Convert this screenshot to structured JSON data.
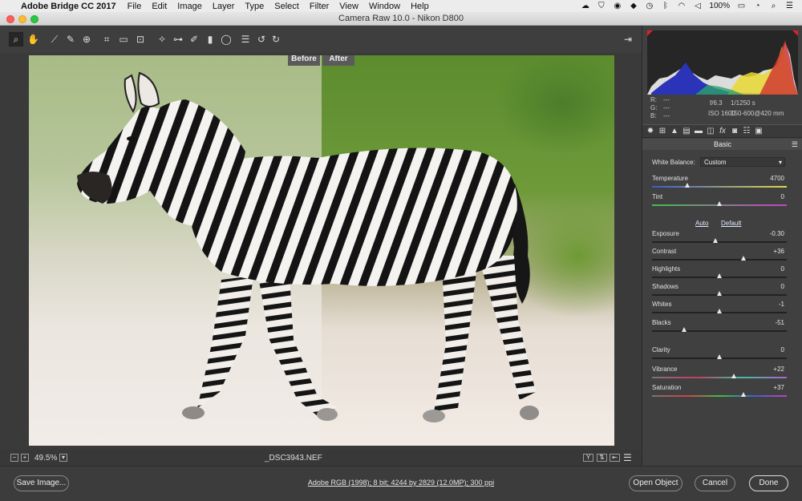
{
  "menubar": {
    "app_name": "Adobe Bridge CC 2017",
    "menus": [
      "File",
      "Edit",
      "Image",
      "Layer",
      "Type",
      "Select",
      "Filter",
      "View",
      "Window",
      "Help"
    ],
    "battery": "100%"
  },
  "window": {
    "title": "Camera Raw 10.0  -  Nikon D800"
  },
  "toolbar": {
    "tools": [
      "zoom-tool",
      "hand-tool",
      "white-balance-tool",
      "color-sampler-tool",
      "targeted-adjustment-tool",
      "crop-tool",
      "straighten-tool",
      "transform-tool",
      "spot-removal-tool",
      "red-eye-tool",
      "adjustment-brush-tool",
      "graduated-filter-tool",
      "radial-filter-tool",
      "presets-list-tool",
      "rotate-ccw-tool",
      "rotate-cw-tool"
    ]
  },
  "preview": {
    "before_label": "Before",
    "after_label": "After"
  },
  "status": {
    "zoom": "49.5%",
    "filename": "_DSC3943.NEF"
  },
  "exif": {
    "r_label": "R:",
    "r_value": "---",
    "g_label": "G:",
    "g_value": "---",
    "b_label": "B:",
    "b_value": "---",
    "aperture": "f/6.3",
    "shutter": "1/1250 s",
    "iso": "ISO 1600",
    "lens": "150-600@420 mm"
  },
  "panel": {
    "title": "Basic",
    "white_balance_label": "White Balance:",
    "white_balance_value": "Custom",
    "auto_label": "Auto",
    "default_label": "Default",
    "sliders": [
      {
        "name": "temperature",
        "label": "Temperature",
        "value": "4700",
        "pos": 0.26
      },
      {
        "name": "tint",
        "label": "Tint",
        "value": "0",
        "pos": 0.5
      },
      {
        "name": "exposure",
        "label": "Exposure",
        "value": "-0.30",
        "pos": 0.47
      },
      {
        "name": "contrast",
        "label": "Contrast",
        "value": "+36",
        "pos": 0.68
      },
      {
        "name": "highlights",
        "label": "Highlights",
        "value": "0",
        "pos": 0.5
      },
      {
        "name": "shadows",
        "label": "Shadows",
        "value": "0",
        "pos": 0.5
      },
      {
        "name": "whites",
        "label": "Whites",
        "value": "-1",
        "pos": 0.5
      },
      {
        "name": "blacks",
        "label": "Blacks",
        "value": "-51",
        "pos": 0.24
      },
      {
        "name": "clarity",
        "label": "Clarity",
        "value": "0",
        "pos": 0.5
      },
      {
        "name": "vibrance",
        "label": "Vibrance",
        "value": "+22",
        "pos": 0.61
      },
      {
        "name": "saturation",
        "label": "Saturation",
        "value": "+37",
        "pos": 0.68
      }
    ]
  },
  "footer": {
    "save_label": "Save Image...",
    "workflow_text": "Adobe RGB (1998); 8 bit; 4244 by 2829 (12.0MP); 300 ppi",
    "open_label": "Open Object",
    "cancel_label": "Cancel",
    "done_label": "Done"
  }
}
